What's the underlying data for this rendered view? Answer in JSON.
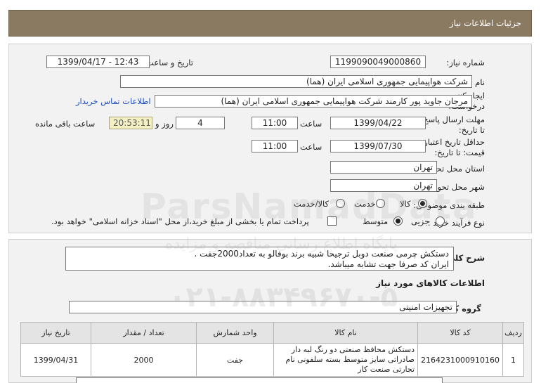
{
  "header": {
    "title": "جزئیات اطلاعات نیاز"
  },
  "fields": {
    "need_number_label": "شماره نیاز:",
    "need_number": "1199090049000860",
    "announce_label": "تاریخ و ساعت اعلان عمومی:",
    "announce_value": "1399/04/17 - 12:43",
    "buyer_label": "نام دستگاه خریدار:",
    "buyer_value": "شرکت هواپیمایی جمهوری اسلامی ایران (هما)",
    "creator_label": "ایجاد کننده درخواست:",
    "creator_value": "مرجان جاوید پور کارمند شرکت هواپیمایی جمهوری اسلامی ایران (هما)",
    "contact_link": "اطلاعات تماس خریدار",
    "reply_deadline_label": "مهلت ارسال پاسخ: تا تاریخ:",
    "reply_date": "1399/04/22",
    "time_label": "ساعت",
    "reply_time": "11:00",
    "days_value": "4",
    "days_label": "روز و",
    "remaining_timer": "20:53:11",
    "remaining_label": "ساعت باقی مانده",
    "validity_label": "حداقل تاریخ اعتبار قیمت: تا تاریخ:",
    "validity_date": "1399/07/30",
    "validity_time": "11:00",
    "province_label": "استان محل تحویل:",
    "province_value": "تهران",
    "city_label": "شهر محل تحویل:",
    "city_value": "تهران",
    "category_label": "طبقه بندی موضوعی:",
    "category_options": [
      "کالا",
      "خدمت",
      "کالا/خدمت"
    ],
    "category_selected": "کالا",
    "purchase_type_label": "نوع فرآیند خرید :",
    "purchase_options": [
      "جزیی",
      "متوسط"
    ],
    "purchase_selected": "متوسط",
    "payment_note": "پرداخت تمام یا بخشی از مبلغ خرید،از محل \"اسناد خزانه اسلامی\" خواهد بود."
  },
  "description": {
    "label": "شرح کلی نیاز:",
    "line1": "دستکش چرمی صنعت دوبل ترجیحا شبیه برند بوفالو به تعداد2000جفت .",
    "line2": "ایران کد صرفا جهت تشابه میباشد."
  },
  "goods": {
    "section_title": "اطلاعات کالاهای مورد نیاز",
    "group_label": "گروه کالا:",
    "group_value": "تجهیزات امنیتی",
    "columns": [
      "ردیف",
      "کد کالا",
      "نام کالا",
      "واحد شمارش",
      "تعداد / مقدار",
      "تاریخ نیاز"
    ],
    "rows": [
      {
        "row": "1",
        "code": "2164231000910160",
        "name": "دستکش محافظ صنعتی دو رنگ لبه دار صادراتی سایز متوسط بسته سلفونی نام تجارتی صنعت کار",
        "unit": "جفت",
        "qty": "2000",
        "date": "1399/04/31"
      }
    ]
  },
  "watermark": {
    "brand": "ParsNamadData",
    "line": "پایگاه اطلاع رسانی مناقصه و مزایده",
    "phone": "۰۲۱-۸۸۳۴۹۶۷۰-۵"
  }
}
